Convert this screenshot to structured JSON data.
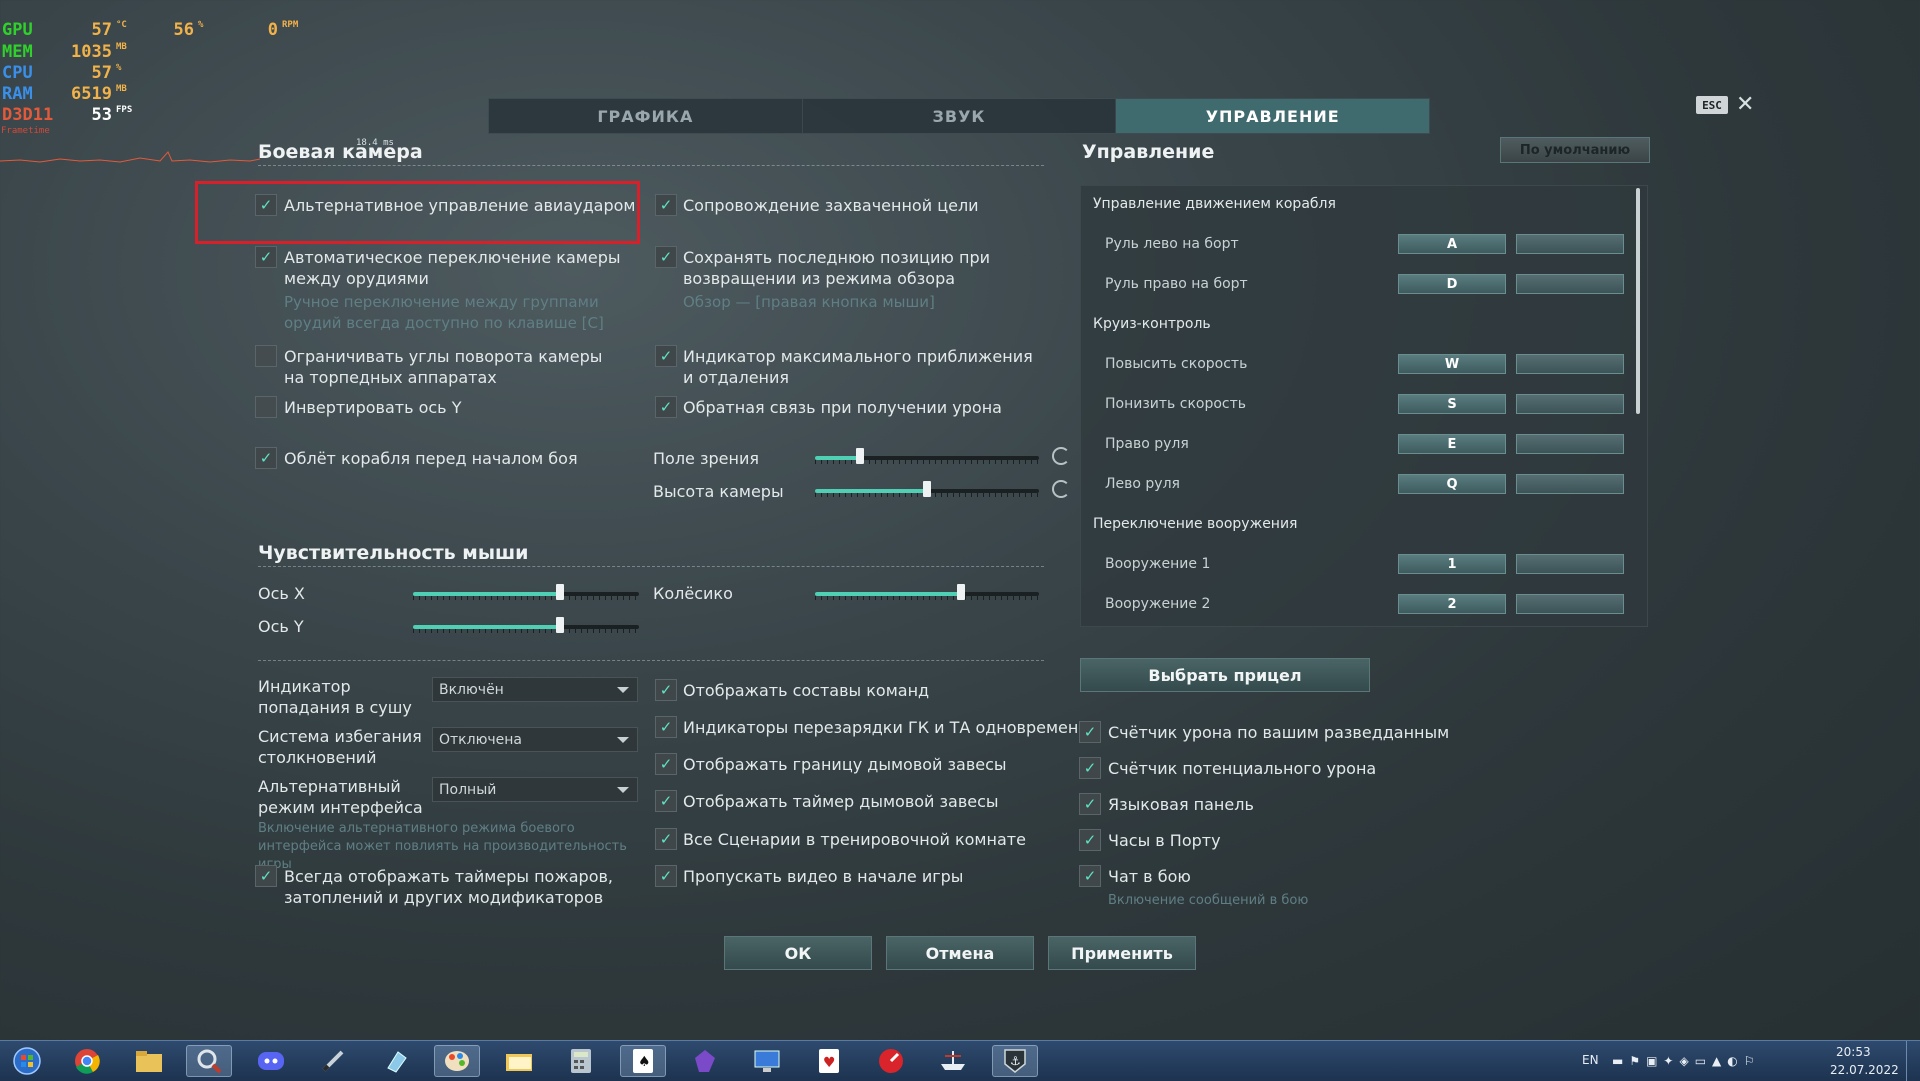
{
  "hud": {
    "rows": [
      {
        "label": "GPU",
        "color": "#2fd12a",
        "value": "57",
        "unit": "°C",
        "value2": "56",
        "unit2": "%",
        "value3": "0",
        "unit3": "RPM"
      },
      {
        "label": "MEM",
        "color": "#2fd12a",
        "value": "1035",
        "unit": "MB"
      },
      {
        "label": "CPU",
        "color": "#3a8fe8",
        "value": "57",
        "unit": "%"
      },
      {
        "label": "RAM",
        "color": "#3a8fe8",
        "value": "6519",
        "unit": "MB"
      },
      {
        "label": "D3D11",
        "color": "#e35a3a",
        "value": "53",
        "unit": "FPS"
      }
    ],
    "frametime_label": "Frametime",
    "frametime_ms": "18.4 ms"
  },
  "tabs": [
    {
      "label": "ГРАФИКА",
      "active": false
    },
    {
      "label": "ЗВУК",
      "active": false
    },
    {
      "label": "УПРАВЛЕНИЕ",
      "active": true
    }
  ],
  "esc_label": "ESC",
  "camera": {
    "title": "Боевая камера",
    "left": [
      {
        "label": "Альтернативное управление авиаударом",
        "checked": true
      },
      {
        "label": "Автоматическое переключение камеры между орудиями",
        "checked": true,
        "hint": "Ручное переключение между группами орудий всегда доступно по клавише [C]"
      },
      {
        "label": "Ограничивать углы поворота камеры на торпедных аппаратах",
        "checked": false
      },
      {
        "label": "Инвертировать ось Y",
        "checked": false
      },
      {
        "label": "Облёт корабля перед началом боя",
        "checked": true
      }
    ],
    "right": [
      {
        "label": "Сопровождение захваченной цели",
        "checked": true
      },
      {
        "label": "Сохранять последнюю позицию при возвращении из режима обзора",
        "checked": true,
        "hint": "Обзор — [правая кнопка мыши]"
      },
      {
        "label": "Индикатор максимального приближения и отдаления",
        "checked": true
      },
      {
        "label": "Обратная связь при получении урона",
        "checked": true
      }
    ],
    "sliders": [
      {
        "label": "Поле зрения",
        "value": 0.2
      },
      {
        "label": "Высота камеры",
        "value": 0.5
      }
    ]
  },
  "mouse": {
    "title": "Чувствительность мыши",
    "sliders": [
      {
        "label": "Ось X",
        "value": 0.65
      },
      {
        "label": "Ось Y",
        "value": 0.65
      },
      {
        "label": "Колёсико",
        "value": 0.65
      }
    ]
  },
  "interface": {
    "selects": [
      {
        "label": "Индикатор попадания в сушу",
        "value": "Включён"
      },
      {
        "label": "Система избегания столкновений",
        "value": "Отключена"
      },
      {
        "label": "Альтернативный режим интерфейса",
        "value": "Полный"
      }
    ],
    "alt_hint": "Включение альтернативного режима боевого интерфейса может повлиять на производительность игры",
    "timers_label": "Всегда отображать таймеры пожаров, затоплений и других модификаторов",
    "middle": [
      {
        "label": "Отображать составы команд",
        "checked": true
      },
      {
        "label": "Индикаторы перезарядки ГК и ТА одновременно",
        "checked": true
      },
      {
        "label": "Отображать границу дымовой завесы",
        "checked": true
      },
      {
        "label": "Отображать таймер дымовой завесы",
        "checked": true
      },
      {
        "label": "Все Сценарии в тренировочной комнате",
        "checked": true
      },
      {
        "label": "Пропускать видео в начале игры",
        "checked": true
      }
    ],
    "right": [
      {
        "label": "Счётчик урона по вашим разведданным",
        "checked": true
      },
      {
        "label": "Счётчик потенциального урона",
        "checked": true
      },
      {
        "label": "Языковая панель",
        "checked": true
      },
      {
        "label": "Часы в Порту",
        "checked": true
      },
      {
        "label": "Чат в бою",
        "checked": true
      }
    ],
    "chat_hint": "Включение сообщений в бою"
  },
  "controls": {
    "title": "Управление",
    "default_button": "По умолчанию",
    "groups": [
      {
        "name": "Управление движением корабля",
        "actions": [
          {
            "label": "Руль лево на борт",
            "key": "A"
          },
          {
            "label": "Руль право на борт",
            "key": "D"
          }
        ]
      },
      {
        "name": "Круиз-контроль",
        "actions": [
          {
            "label": "Повысить скорость",
            "key": "W"
          },
          {
            "label": "Понизить скорость",
            "key": "S"
          },
          {
            "label": "Право руля",
            "key": "E"
          },
          {
            "label": "Лево руля",
            "key": "Q"
          }
        ]
      },
      {
        "name": "Переключение вооружения",
        "actions": [
          {
            "label": "Вооружение 1",
            "key": "1"
          },
          {
            "label": "Вооружение 2",
            "key": "2"
          }
        ]
      }
    ],
    "crosshair_button": "Выбрать прицел"
  },
  "buttons": {
    "ok": "ОК",
    "cancel": "Отмена",
    "apply": "Применить"
  },
  "taskbar": {
    "icons": [
      "start-orb-icon",
      "chrome-icon",
      "explorer-icon",
      "magnifier-icon",
      "discord-icon",
      "pen-icon",
      "eraser-icon",
      "paint-icon",
      "folder-icon",
      "calculator-icon",
      "solitaire-icon",
      "crystal-icon",
      "screen-icon",
      "cards-icon",
      "speed-icon",
      "ship-icon",
      "game-anchor-icon"
    ],
    "lang": "EN",
    "time": "20:53",
    "date": "22.07.2022"
  }
}
